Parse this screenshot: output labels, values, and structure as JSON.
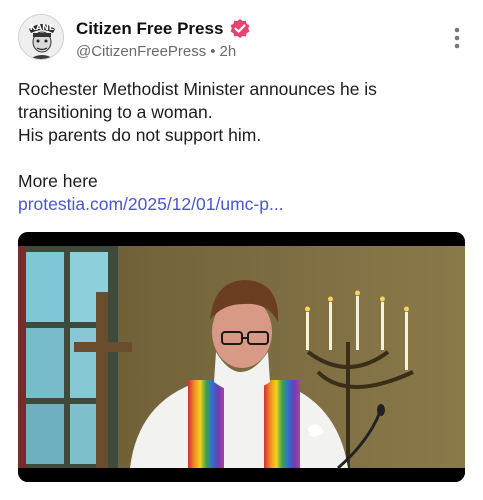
{
  "post": {
    "author": {
      "display_name": "Citizen Free Press",
      "handle": "@CitizenFreePress",
      "separator": "•",
      "time": "2h",
      "avatar_text": "KANE"
    },
    "text_lines": [
      "Rochester Methodist Minister announces he is",
      "transitioning to a woman.",
      "His parents do not support him."
    ],
    "more_label": "More here",
    "link_text": "protestia.com/2025/12/01/umc-p...",
    "icons": {
      "verified": "verified-badge-icon",
      "menu": "more-vertical-icon"
    },
    "colors": {
      "verified": "#e8436e",
      "link": "#4a55d6",
      "meta": "#6b6b6b"
    }
  }
}
